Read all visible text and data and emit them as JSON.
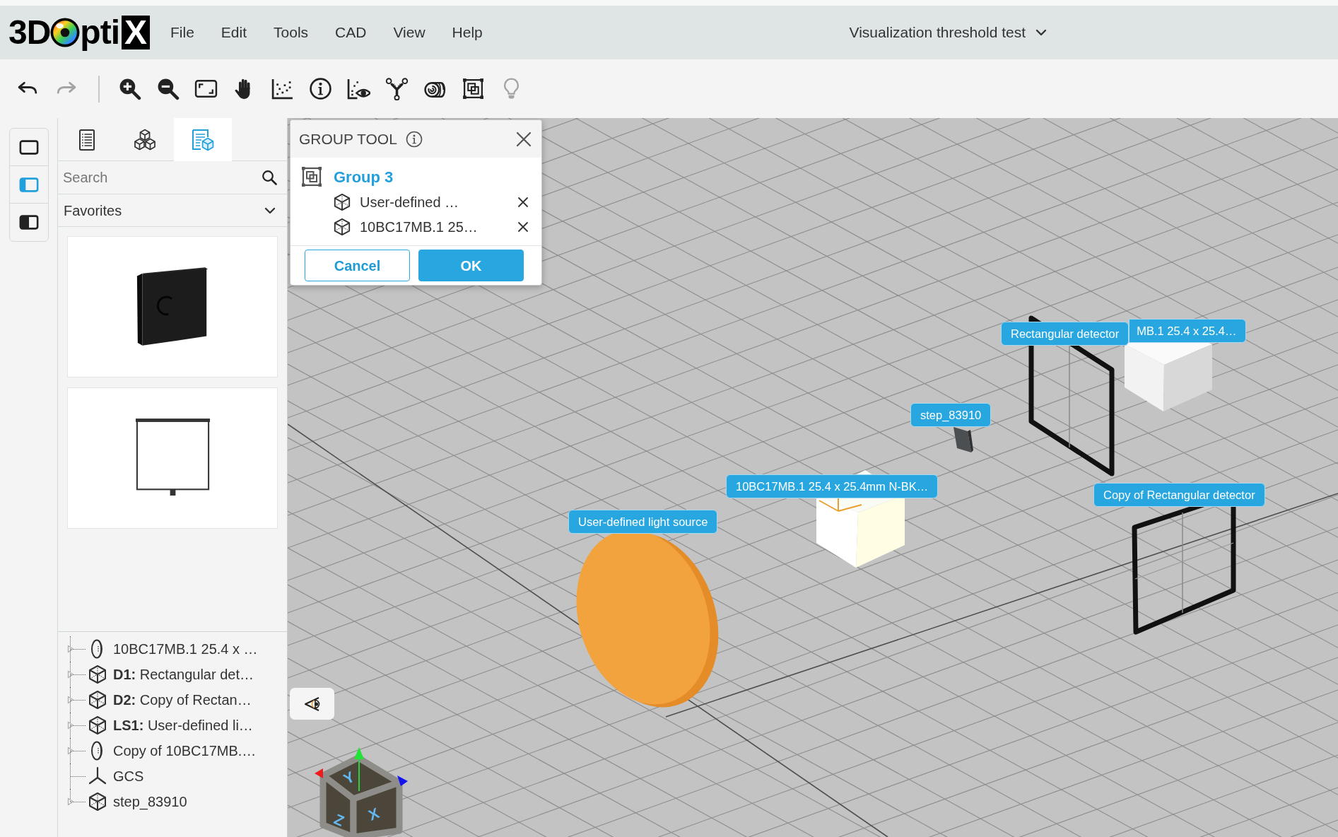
{
  "logo": {
    "lead": "3D",
    "tail": "pti",
    "boxed": "X"
  },
  "menu": [
    "File",
    "Edit",
    "Tools",
    "CAD",
    "View",
    "Help"
  ],
  "project": {
    "title": "Visualization threshold test"
  },
  "toolbar": {
    "history": [
      {
        "kind": "undo",
        "disabled": false
      },
      {
        "kind": "redo",
        "disabled": true
      }
    ],
    "tools": [
      {
        "kind": "zoom_in",
        "disabled": false
      },
      {
        "kind": "zoom_out",
        "disabled": false
      },
      {
        "kind": "fit",
        "disabled": false
      },
      {
        "kind": "pan",
        "disabled": false
      },
      {
        "kind": "scatter",
        "disabled": false
      },
      {
        "kind": "info",
        "disabled": false
      },
      {
        "kind": "chart_eye",
        "disabled": false
      },
      {
        "kind": "branch",
        "disabled": false
      },
      {
        "kind": "roll",
        "disabled": false
      },
      {
        "kind": "group",
        "disabled": false
      },
      {
        "kind": "bulb",
        "disabled": true
      }
    ]
  },
  "layout_buttons": [
    {
      "kind": "plain",
      "selected": false
    },
    {
      "kind": "left_panel",
      "selected": true
    },
    {
      "kind": "left_half",
      "selected": false
    }
  ],
  "panel": {
    "tabs": [
      {
        "kind": "list",
        "selected": false
      },
      {
        "kind": "parts",
        "selected": false
      },
      {
        "kind": "catalog",
        "selected": true
      }
    ],
    "search": {
      "placeholder": "Search"
    },
    "filter": {
      "value": "Favorites"
    },
    "favorites": [
      {
        "kind": "plate"
      },
      {
        "kind": "screen"
      }
    ],
    "tree": [
      {
        "kind": "lens",
        "label": "10BC17MB.1 25.4 x …",
        "expandable": true
      },
      {
        "kind": "box",
        "label": "**D1:** Rectangular det…",
        "expandable": true
      },
      {
        "kind": "box",
        "label": "**D2:** Copy of Rectan…",
        "expandable": true
      },
      {
        "kind": "box",
        "label": "**LS1:** User-defined li…",
        "expandable": true
      },
      {
        "kind": "lens",
        "label": "Copy of 10BC17MB.…",
        "expandable": true
      },
      {
        "kind": "axes",
        "label": "GCS",
        "expandable": false
      },
      {
        "kind": "box",
        "label": "step_83910",
        "expandable": true
      }
    ]
  },
  "group_tool": {
    "title": "GROUP TOOL",
    "group": "Group 3",
    "members": [
      {
        "label": "User-defined …"
      },
      {
        "label": "10BC17MB.1 25…"
      }
    ],
    "cancel": "Cancel",
    "ok": "OK"
  },
  "viewport": {
    "labels": [
      "Rectangular detector",
      "MB.1 25.4 x 25.4…",
      "step_83910",
      "10BC17MB.1 25.4 x 25.4mm N-BK…",
      "Copy of Rectangular detector",
      "User-defined light source"
    ],
    "view_cube": {
      "top": "Y",
      "left": "Z",
      "right": "X"
    }
  }
}
